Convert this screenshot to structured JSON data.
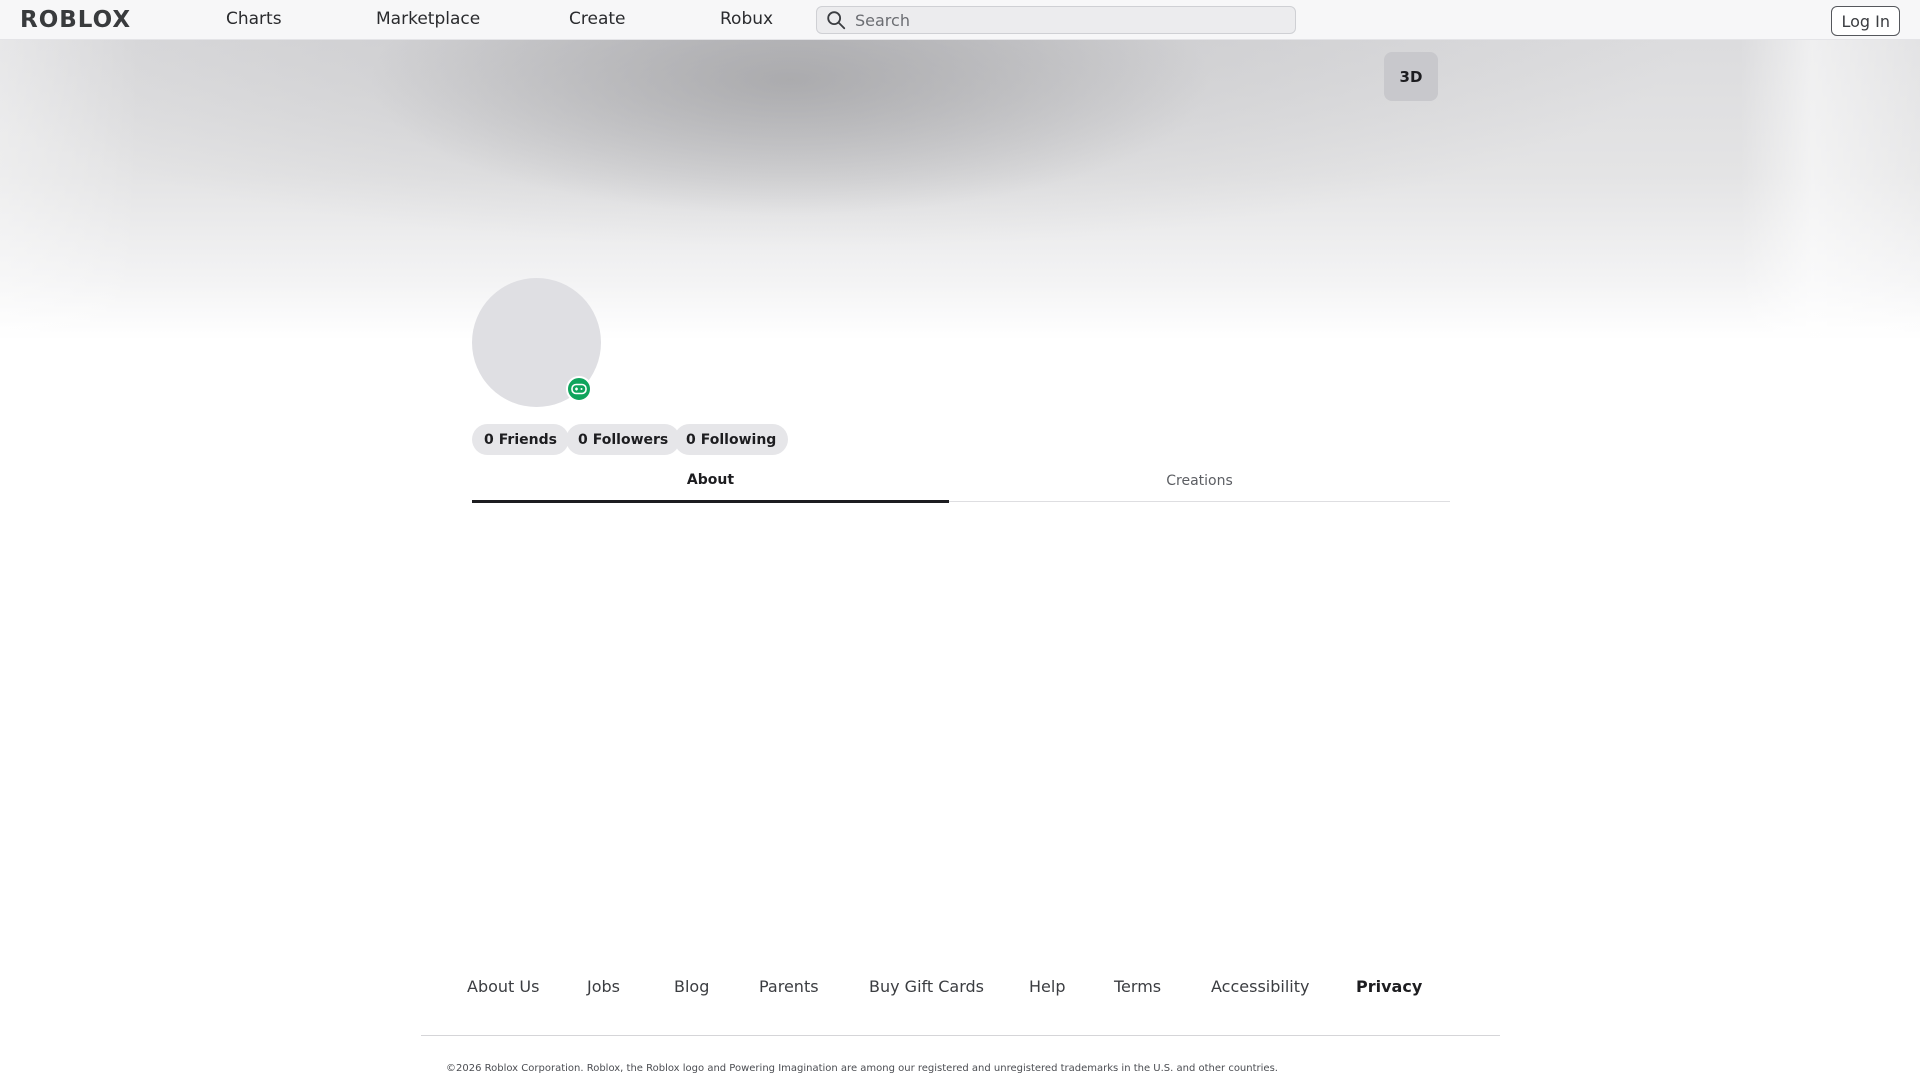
{
  "header": {
    "logo_text": "ROBLOX",
    "nav": [
      "Charts",
      "Marketplace",
      "Create",
      "Robux"
    ],
    "search": {
      "placeholder": "Search",
      "value": ""
    },
    "login_label": "Log In"
  },
  "banner": {
    "view_toggle_label": "3D"
  },
  "profile": {
    "status_icon": "gamepad-icon",
    "stats": [
      {
        "count": "0",
        "label": "Friends"
      },
      {
        "count": "0",
        "label": "Followers"
      },
      {
        "count": "0",
        "label": "Following"
      }
    ],
    "tabs": [
      {
        "label": "About",
        "active": true
      },
      {
        "label": "Creations",
        "active": false
      }
    ]
  },
  "footer": {
    "links": [
      "About Us",
      "Jobs",
      "Blog",
      "Parents",
      "Buy Gift Cards",
      "Help",
      "Terms",
      "Accessibility",
      "Privacy"
    ],
    "copyright": "©2026 Roblox Corporation. Roblox, the Roblox logo and Powering Imagination are among our registered and unregistered trademarks in the U.S. and other countries."
  },
  "colors": {
    "status_green": "#0fa45c",
    "pill_bg": "#e6e6e9",
    "avatar_bg": "#dfdfe3"
  }
}
